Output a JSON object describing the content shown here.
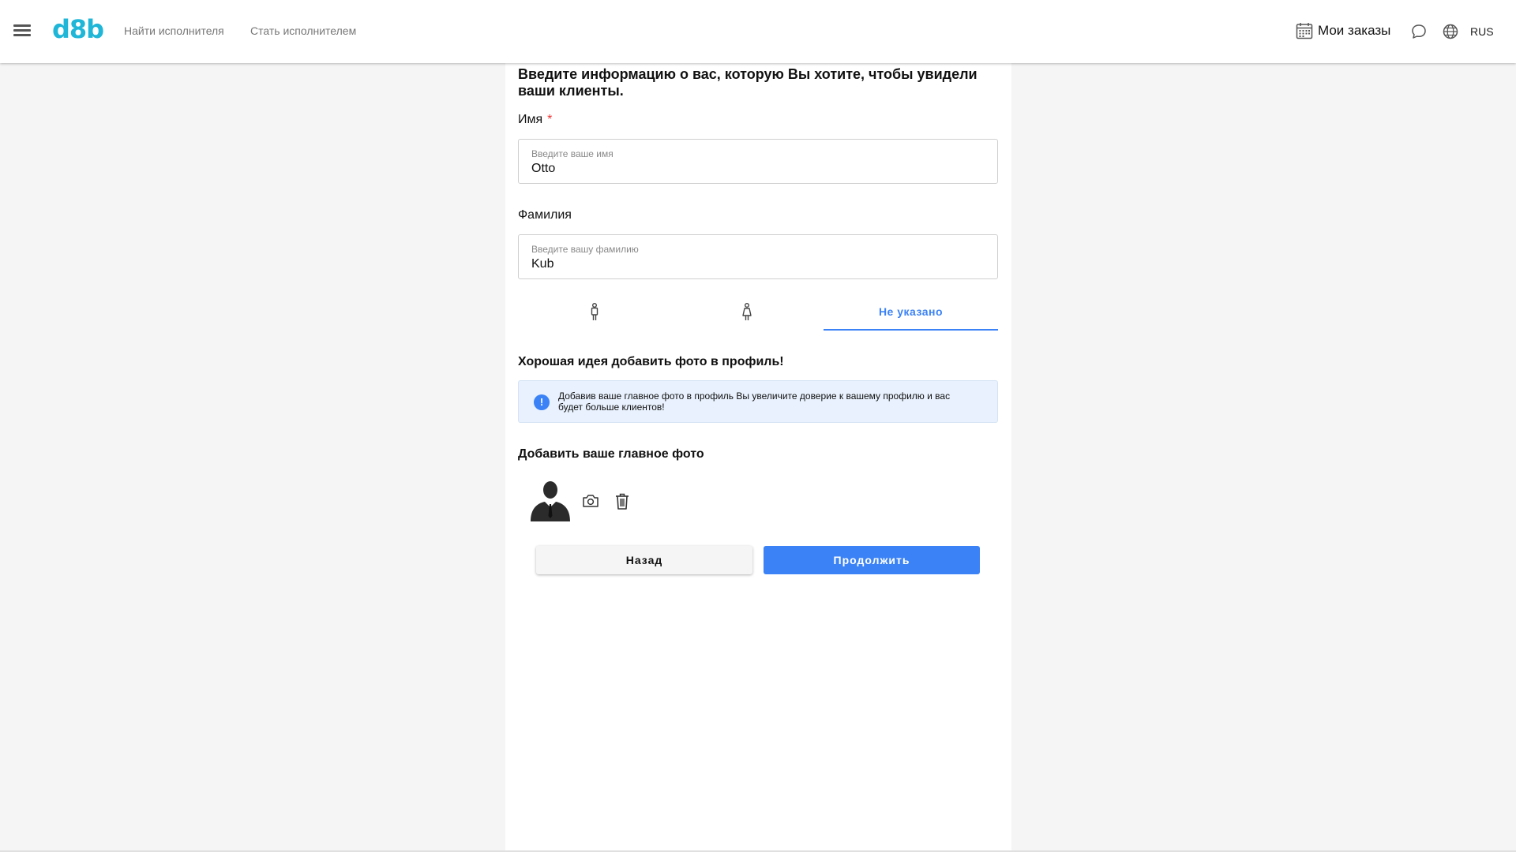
{
  "header": {
    "logo": "d8b",
    "nav": {
      "find_performer": "Найти исполнителя",
      "become_performer": "Стать исполнителем"
    },
    "orders_label": "Мои заказы",
    "language": "RUS"
  },
  "form": {
    "heading": "Введите информацию о вас, которую Вы хотите, чтобы увидели ваши клиенты.",
    "first_name": {
      "label": "Имя",
      "required_mark": "*",
      "placeholder": "Введите ваше имя",
      "value": "Otto"
    },
    "last_name": {
      "label": "Фамилия",
      "placeholder": "Введите вашу фамилию",
      "value": "Kub"
    },
    "gender_tabs": {
      "selected": "none",
      "none_label": "Не указано"
    },
    "photo_tip_title": "Хорошая идея добавить фото в профиль!",
    "photo_tip_text": "Добавив ваше главное фото в профиль Вы увеличите доверие к вашему профилю и вас будет больше клиентов!",
    "photo_section_title": "Добавить ваше главное фото",
    "back_button": "Назад",
    "continue_button": "Продолжить"
  },
  "colors": {
    "accent": "#3b82f6",
    "logo": "#1fb6d8",
    "info_bg": "#e8f1fd",
    "required": "#e33333"
  }
}
